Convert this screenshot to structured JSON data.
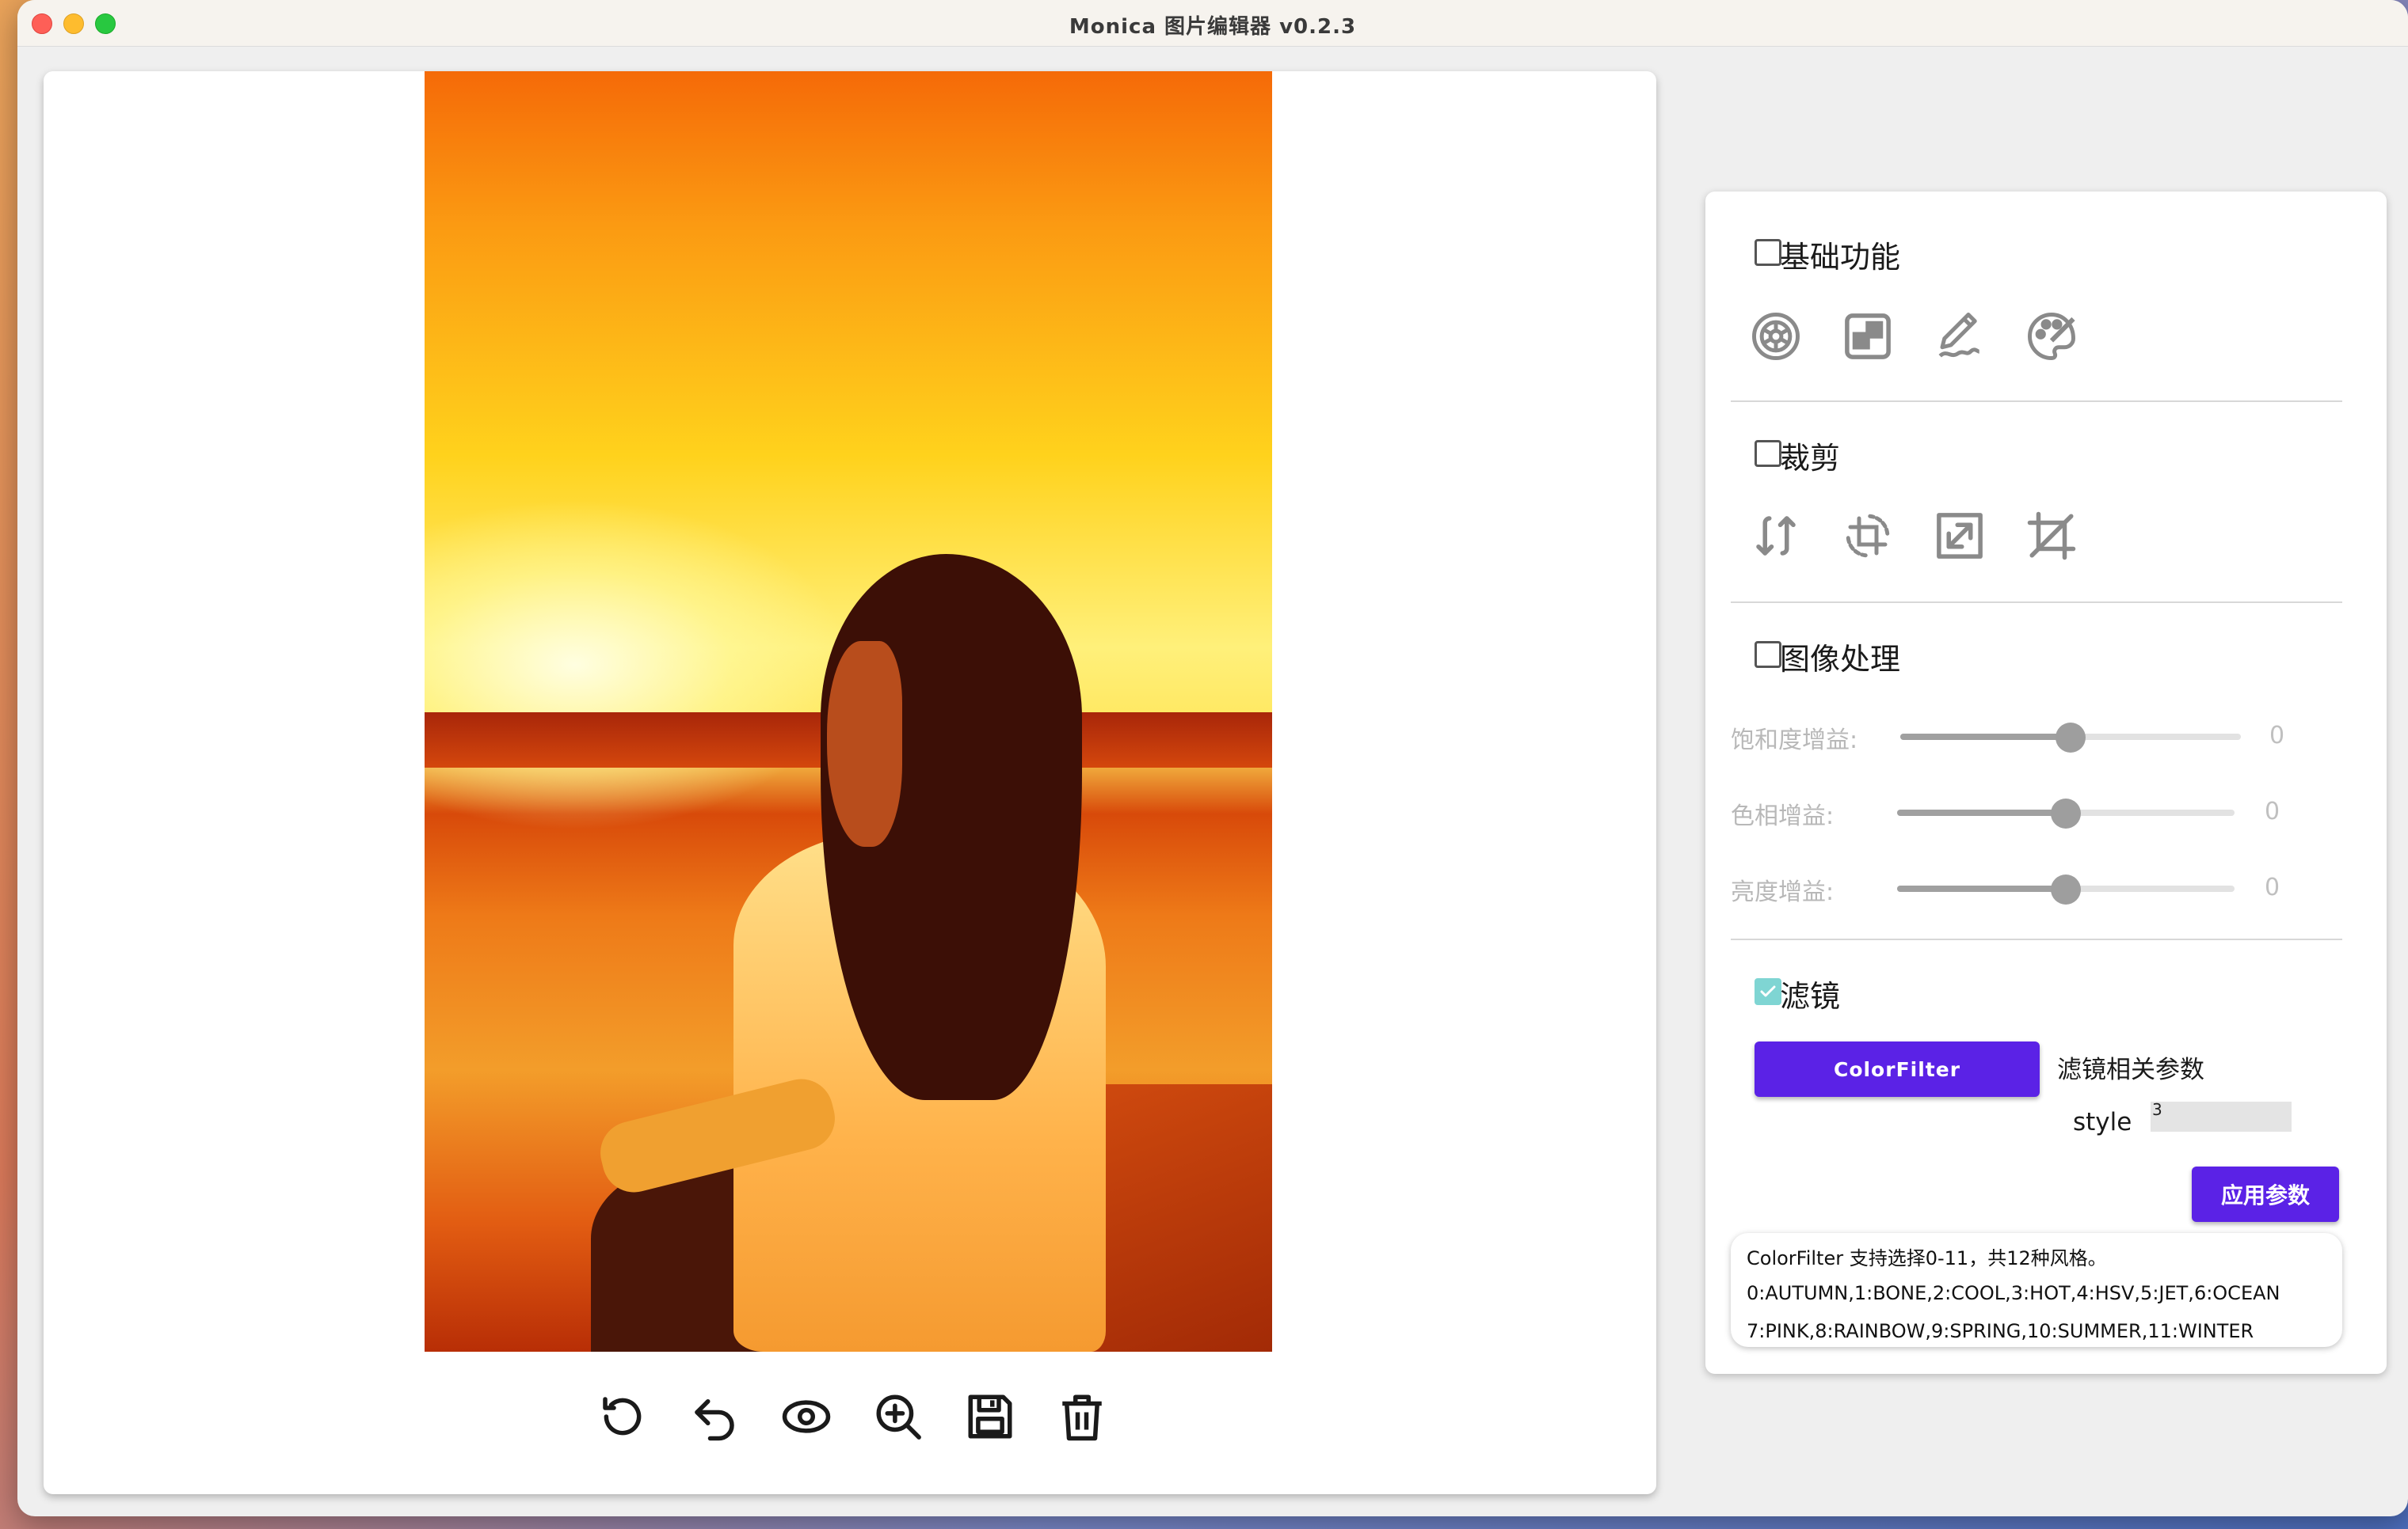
{
  "window": {
    "title": "Monica 图片编辑器 v0.2.3"
  },
  "canvas": {
    "image_alt": "sunset photo with color filter applied",
    "toolbar": [
      {
        "name": "rotate-icon"
      },
      {
        "name": "undo-icon"
      },
      {
        "name": "preview-eye-icon"
      },
      {
        "name": "zoom-in-icon"
      },
      {
        "name": "save-icon"
      },
      {
        "name": "delete-icon"
      }
    ]
  },
  "panel": {
    "basic": {
      "title": "基础功能",
      "checked": false,
      "icons": [
        "shutter-icon",
        "mosaic-icon",
        "draw-pen-icon",
        "palette-icon"
      ]
    },
    "crop": {
      "title": "裁剪",
      "checked": false,
      "icons": [
        "flip-icon",
        "rotate-crop-icon",
        "resize-icon",
        "crop-icon"
      ]
    },
    "image_processing": {
      "title": "图像处理",
      "checked": false,
      "sliders": [
        {
          "label": "饱和度增益:",
          "value": "0",
          "level": 0.5
        },
        {
          "label": "色相增益:",
          "value": "0",
          "level": 0.5
        },
        {
          "label": "亮度增益:",
          "value": "0",
          "level": 0.5
        }
      ]
    },
    "filter": {
      "title": "滤镜",
      "checked": true,
      "filter_button": "ColorFilter",
      "params_label": "滤镜相关参数",
      "style_label": "style",
      "style_value": "3",
      "apply_button": "应用参数",
      "info_lines": [
        "ColorFilter 支持选择0-11，共12种风格。",
        "0:AUTUMN,1:BONE,2:COOL,3:HOT,4:HSV,5:JET,6:OCEAN",
        "7:PINK,8:RAINBOW,9:SPRING,10:SUMMER,11:WINTER"
      ]
    }
  },
  "colors": {
    "accent": "#5b22e6",
    "checkbox_checked": "#7fd5d3",
    "slider_thumb": "#9e9e9e"
  }
}
